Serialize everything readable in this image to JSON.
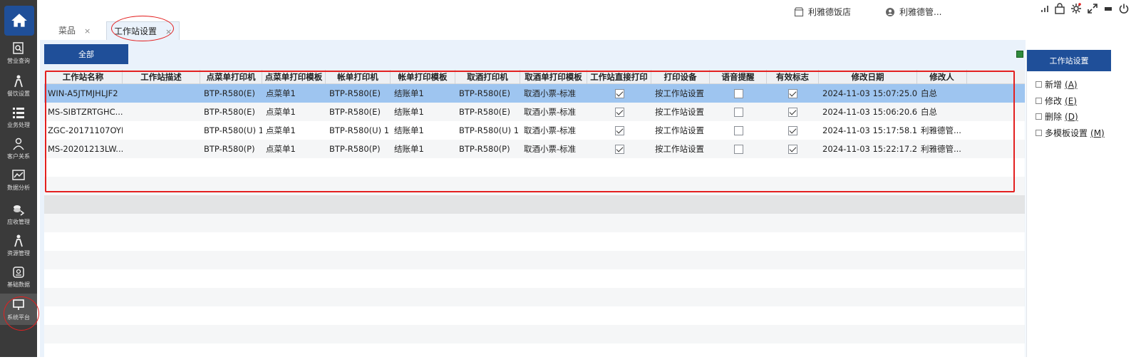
{
  "sidebar": {
    "items": [
      {
        "label": "营业查询",
        "icon": "search-report-icon"
      },
      {
        "label": "餐饮设置",
        "icon": "person-settings-icon"
      },
      {
        "label": "业务处理",
        "icon": "list-icon"
      },
      {
        "label": "客户关系",
        "icon": "people-icon"
      },
      {
        "label": "数据分析",
        "icon": "line-chart-icon"
      },
      {
        "label": "应收管理",
        "icon": "money-icon"
      },
      {
        "label": "资源管理",
        "icon": "person-resource-icon"
      },
      {
        "label": "基础数据",
        "icon": "database-icon"
      },
      {
        "label": "系统平台",
        "icon": "monitor-icon"
      }
    ]
  },
  "tabs": [
    {
      "label": "菜品",
      "close": "×"
    },
    {
      "label": "工作站设置",
      "close": "×"
    }
  ],
  "topbar": {
    "store": "利雅德饭店",
    "user": "利雅德管..."
  },
  "toolbar": {
    "all_label": "全部"
  },
  "table": {
    "columns": [
      "工作站名称",
      "工作站描述",
      "点菜单打印机",
      "点菜单打印模板",
      "帐单打印机",
      "帐单打印模板",
      "取酒打印机",
      "取酒单打印模板",
      "工作站直接打印",
      "打印设备",
      "语音提醒",
      "有效标志",
      "修改日期",
      "修改人"
    ],
    "rows": [
      {
        "name": "WIN-A5JTMJHLJF2",
        "desc": "",
        "order_printer": "BTP-R580(E)",
        "order_tpl": "点菜单1",
        "bill_printer": "BTP-R580(E)",
        "bill_tpl": "结账单1",
        "wine_printer": "BTP-R580(E)",
        "wine_tpl": "取酒小票-标准",
        "direct": true,
        "device": "按工作站设置",
        "voice": false,
        "valid": true,
        "date": "2024-11-03 15:07:25.0...",
        "by": "白总"
      },
      {
        "name": "MS-SIBTZRTGHC...",
        "desc": "",
        "order_printer": "BTP-R580(E)",
        "order_tpl": "点菜单1",
        "bill_printer": "BTP-R580(E)",
        "bill_tpl": "结账单1",
        "wine_printer": "BTP-R580(E)",
        "wine_tpl": "取酒小票-标准",
        "direct": true,
        "device": "按工作站设置",
        "voice": false,
        "valid": true,
        "date": "2024-11-03 15:06:20.6...",
        "by": "白总"
      },
      {
        "name": "ZGC-20171107OYI",
        "desc": "",
        "order_printer": "BTP-R580(U) 1",
        "order_tpl": "点菜单1",
        "bill_printer": "BTP-R580(U) 1",
        "bill_tpl": "结账单1",
        "wine_printer": "BTP-R580(U) 1",
        "wine_tpl": "取酒小票-标准",
        "direct": true,
        "device": "按工作站设置",
        "voice": false,
        "valid": true,
        "date": "2024-11-03 15:17:58.1...",
        "by": "利雅德管..."
      },
      {
        "name": "MS-20201213LW...",
        "desc": "",
        "order_printer": "BTP-R580(P)",
        "order_tpl": "点菜单1",
        "bill_printer": "BTP-R580(P)",
        "bill_tpl": "结账单1",
        "wine_printer": "BTP-R580(P)",
        "wine_tpl": "取酒小票-标准",
        "direct": true,
        "device": "按工作站设置",
        "voice": false,
        "valid": true,
        "date": "2024-11-03 15:22:17.2...",
        "by": "利雅德管..."
      }
    ],
    "selected_row": 0
  },
  "right_panel": {
    "title": "工作站设置",
    "actions": [
      {
        "label": "新增",
        "key": "(A)"
      },
      {
        "label": "修改",
        "key": "(E)"
      },
      {
        "label": "删除",
        "key": "(D)"
      },
      {
        "label": "多模板设置",
        "key": "(M)"
      }
    ]
  },
  "colors": {
    "sidebar_bg": "#3a3a3a",
    "accent": "#1f4f99",
    "selected_row": "#9ec5f0",
    "annotation": "#e32020"
  }
}
